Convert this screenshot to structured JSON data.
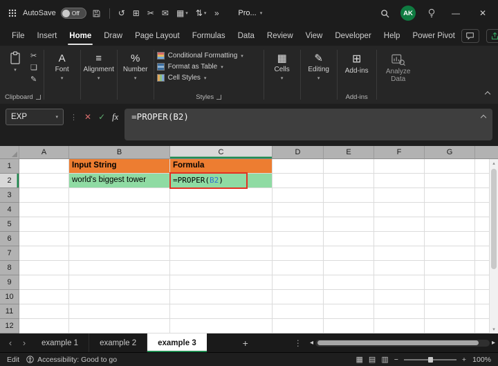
{
  "colors": {
    "accent_green": "#1E8A4F",
    "orange_fill": "#ED7D31",
    "green_fill": "#8FDBA3",
    "reference_blue": "#2F6FD0",
    "annotation_red": "#E33022"
  },
  "icons": {
    "dropdown": "▾",
    "minimize": "—",
    "close": "✕",
    "overflow": "»",
    "dots": "⋮",
    "cancel": "✕",
    "enter": "✓",
    "fx": "fx",
    "cut_small": "✂",
    "copy_small": "❏",
    "format_painter_small": "✎",
    "font_big": "A",
    "alignment_big": "≡",
    "number_big": "%",
    "cells_big": "▦",
    "editing_big": "✎",
    "addins_big": "⊞",
    "sheet_prev": "‹",
    "sheet_next": "›",
    "add_sheet": "+",
    "kebab": "⋮",
    "hscroll_left": "◂",
    "hscroll_right": "▸",
    "vscroll_up": "▴",
    "vscroll_down": "▾",
    "zoom_out": "−",
    "zoom_in": "+"
  },
  "titlebar": {
    "autosave_label": "AutoSave",
    "autosave_state": "Off",
    "title": "Pro...",
    "avatar_initials": "AK",
    "qat_icons": [
      {
        "name": "undo-icon",
        "glyph": "↺",
        "dropdown": false
      },
      {
        "name": "insert-table-icon",
        "glyph": "⊞",
        "dropdown": false
      },
      {
        "name": "cut-icon",
        "glyph": "✂",
        "dropdown": false
      },
      {
        "name": "envelope-icon",
        "glyph": "✉",
        "dropdown": false
      },
      {
        "name": "borders-icon",
        "glyph": "▦",
        "dropdown": true
      },
      {
        "name": "sort-icon",
        "glyph": "⇅",
        "dropdown": true
      }
    ]
  },
  "tabs": {
    "items": [
      "File",
      "Insert",
      "Home",
      "Draw",
      "Page Layout",
      "Formulas",
      "Data",
      "Review",
      "View",
      "Developer",
      "Help",
      "Power Pivot"
    ],
    "active": "Home"
  },
  "ribbon": {
    "clipboard": {
      "label": "Clipboard"
    },
    "font": {
      "label": "Font"
    },
    "alignment": {
      "label": "Alignment"
    },
    "number": {
      "label": "Number"
    },
    "styles": {
      "label": "Styles",
      "buttons": [
        "Conditional Formatting",
        "Format as Table",
        "Cell Styles"
      ]
    },
    "cells": {
      "label": "Cells"
    },
    "editing": {
      "label": "Editing"
    },
    "addins": {
      "button_label": "Add-ins",
      "group_label": "Add-ins"
    },
    "analyze": {
      "label": "Analyze Data"
    }
  },
  "formula_bar": {
    "name_box": "EXP",
    "formula": "=PROPER(B2)"
  },
  "grid": {
    "columns": [
      "A",
      "B",
      "C",
      "D",
      "E",
      "F",
      "G"
    ],
    "rows": [
      "1",
      "2",
      "3",
      "4",
      "5",
      "6",
      "7",
      "8",
      "9",
      "10",
      "11",
      "12"
    ],
    "active_cell": "C2",
    "cells": {
      "B1": {
        "text": "Input String",
        "bold": true,
        "fill": "#ED7D31"
      },
      "C1": {
        "text": "Formula",
        "bold": true,
        "fill": "#ED7D31"
      },
      "B2": {
        "text": "world's biggest tower",
        "fill": "#8FDBA3"
      },
      "C2": {
        "fill": "#8FDBA3",
        "mono": true,
        "annotated": true,
        "parts": [
          {
            "t": "=PROPER("
          },
          {
            "t": "B2",
            "color": "#2F6FD0"
          },
          {
            "t": ")"
          }
        ]
      }
    }
  },
  "sheet_bar": {
    "tabs": [
      "example 1",
      "example 2",
      "example 3"
    ],
    "active": "example 3"
  },
  "status_bar": {
    "mode": "Edit",
    "accessibility": "Accessibility: Good to go",
    "zoom": "100%",
    "view_icons": [
      {
        "name": "normal-view-icon",
        "glyph": "▦"
      },
      {
        "name": "page-layout-view-icon",
        "glyph": "▤"
      },
      {
        "name": "page-break-view-icon",
        "glyph": "▥"
      }
    ]
  }
}
